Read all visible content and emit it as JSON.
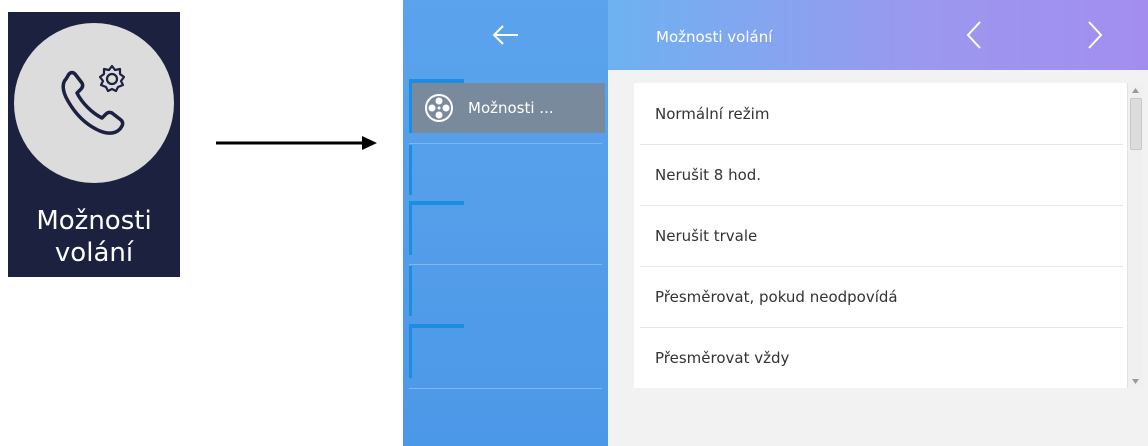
{
  "app_tile": {
    "label_line1": "Možnosti",
    "label_line2": "volání",
    "icon": "phone-settings-icon",
    "background": "#1c2140"
  },
  "screen": {
    "back_icon": "arrow-left-icon",
    "header": {
      "title": "Možnosti volání",
      "prev_icon": "chevron-left-icon",
      "next_icon": "chevron-right-icon"
    },
    "sidebar": {
      "active_item": {
        "label": "Možnosti ...",
        "icon": "film-reel-icon"
      }
    },
    "menu": [
      {
        "label": "Normální režim"
      },
      {
        "label": "Nerušit 8 hod."
      },
      {
        "label": "Nerušit trvale"
      },
      {
        "label": "Přesměrovat, pokud neodpovídá"
      },
      {
        "label": "Přesměrovat vždy"
      }
    ],
    "colors": {
      "sidebar": "#4c98e8",
      "active_item": "#7a8a9d",
      "header_start": "#6eb2f0",
      "header_end": "#a38ef0"
    }
  }
}
